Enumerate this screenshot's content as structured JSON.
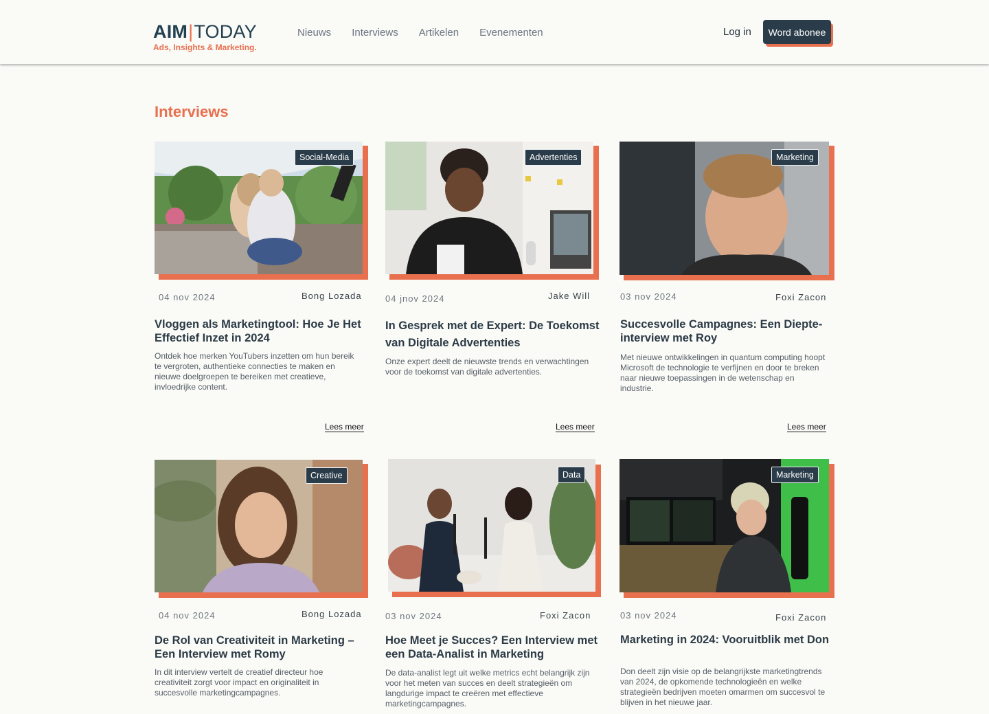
{
  "header": {
    "logo_main_1": "AIM",
    "logo_sep": "|",
    "logo_main_2": "TODAY",
    "logo_tagline": "Ads, Insights & Marketing.",
    "nav": [
      "Nieuws",
      "Interviews",
      "Artikelen",
      "Evenementen"
    ],
    "login_label": "Log in",
    "subscribe_label": "Word abonee"
  },
  "section_title": "Interviews",
  "cards": [
    {
      "category": "Social-Media",
      "date": "04 nov 2024",
      "author": "Bong Lozada",
      "title": "Vloggen als Marketingtool: Hoe Je Het Effectief Inzet in 2024",
      "description": " Ontdek hoe merken YouTubers inzetten om hun bereik te vergroten, authentieke connecties te maken en nieuwe doelgroepen te bereiken met creatieve, invloedrijke content.",
      "read_more": "Lees meer"
    },
    {
      "category": "Advertenties",
      "date": "04 jnov 2024",
      "author": "Jake Will",
      "title": "In Gesprek met de Expert: De Toekomst van Digitale Advertenties",
      "description": "Onze expert deelt de nieuwste trends en verwachtingen voor de toekomst van digitale advertenties.",
      "read_more": "Lees meer"
    },
    {
      "category": "Marketing",
      "date": "03 nov 2024",
      "author": "Foxi Zacon",
      "title": "Succesvolle Campagnes: Een Diepte-interview met Roy",
      "description": "Met nieuwe ontwikkelingen in quantum computing hoopt Microsoft de technologie te verfijnen en door te breken naar nieuwe toepassingen in de wetenschap en industrie.",
      "read_more": "Lees meer"
    },
    {
      "category": "Creative",
      "date": "04 nov 2024",
      "author": "Bong Lozada",
      "title": "De Rol van Creativiteit in Marketing – Een Interview met Romy",
      "description": "In dit interview vertelt de creatief directeur hoe creativiteit zorgt voor impact en originaliteit in succesvolle marketingcampagnes."
    },
    {
      "category": "Data",
      "date": "03 nov 2024",
      "author": "Foxi Zacon",
      "title": "Hoe Meet je Succes? Een Interview met een Data-Analist in Marketing",
      "description": "De data-analist legt uit welke metrics echt belangrijk zijn voor het meten van succes en deelt strategieën om langdurige impact te creëren met effectieve marketingcampagnes."
    },
    {
      "category": "Marketing",
      "date": "03 nov 2024",
      "author": "Foxi Zacon",
      "title": "Marketing in 2024: Vooruitblik met Don",
      "description": "Don deelt zijn visie op de belangrijkste marketingtrends van 2024, de opkomende technologieën en welke strategieën bedrijven moeten omarmen om succesvol te blijven in het nieuwe jaar."
    }
  ],
  "colors": {
    "accent": "#e8704f",
    "dark": "#2a3c49",
    "background": "#fafaf7"
  }
}
